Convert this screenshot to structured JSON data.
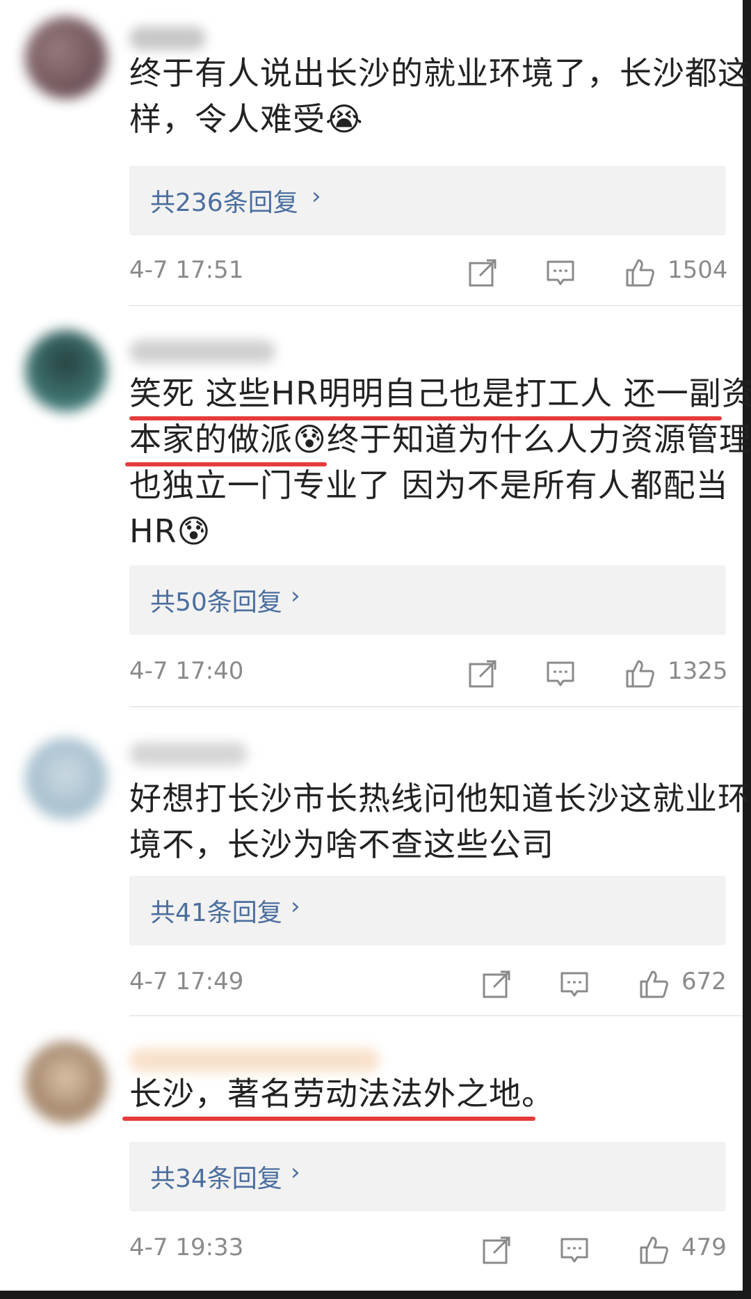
{
  "comments": [
    {
      "lines": [
        "终于有人说出长沙的就业环境了，长沙都这",
        "样，令人难受😭"
      ],
      "replies_label": "共236条回复",
      "time": "4-7 17:51",
      "likes": "1504",
      "avatar_color": "#7a5a5e"
    },
    {
      "lines": [
        "笑死 这些HR明明自己也是打工人 还一副资",
        "本家的做派😰终于知道为什么人力资源管理",
        "也独立一门专业了 因为不是所有人都配当",
        "HR😰"
      ],
      "replies_label": "共50条回复",
      "time": "4-7 17:40",
      "likes": "1325",
      "avatar_color": "#2f5d5a"
    },
    {
      "lines": [
        "好想打长沙市长热线问他知道长沙这就业环",
        "境不，长沙为啥不查这些公司"
      ],
      "replies_label": "共41条回复",
      "time": "4-7 17:49",
      "likes": "672",
      "avatar_color": "#8fb0c4"
    },
    {
      "lines": [
        "长沙，著名劳动法法外之地。"
      ],
      "replies_label": "共34条回复",
      "time": "4-7 19:33",
      "likes": "479",
      "avatar_color": "#a08060"
    }
  ],
  "icons": {
    "share": "share-icon",
    "comment": "comment-icon",
    "like": "like-icon",
    "chevron": "chevron-right-icon"
  },
  "colors": {
    "reply_link": "#4a6e9e",
    "meta_text": "#8a8a8a",
    "highlight_underline": "#e53b3b",
    "reply_box_bg": "#f2f2f2"
  }
}
